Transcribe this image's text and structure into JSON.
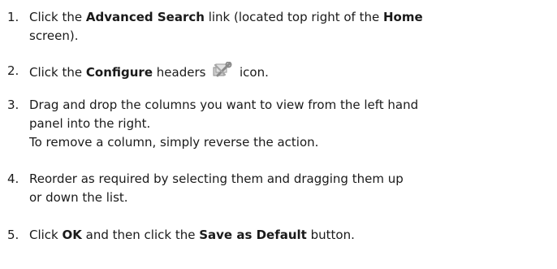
{
  "steps": [
    {
      "number": "1.",
      "lines": [
        [
          "Click the ",
          "Advanced Search",
          " link (located top right of the ",
          "Home"
        ],
        [
          "screen)."
        ]
      ]
    },
    {
      "number": "2.",
      "parts": [
        "Click the ",
        "Configure",
        " headers ",
        " icon."
      ],
      "icon": "configure-wrench-icon"
    },
    {
      "number": "3.",
      "lines": [
        "Drag and drop the columns you want to view from the left hand",
        "panel into the right.",
        "To remove a column, simply reverse the action."
      ]
    },
    {
      "number": "4.",
      "lines": [
        "Reorder as required by selecting them and dragging them up",
        "or down the list."
      ]
    },
    {
      "number": "5.",
      "parts": [
        "Click ",
        "OK",
        " and then click the ",
        "Save as Default",
        " button."
      ]
    }
  ],
  "colors": {
    "text": "#1a1a1a",
    "background": "#ffffff",
    "icon": "#9a9a9a"
  }
}
